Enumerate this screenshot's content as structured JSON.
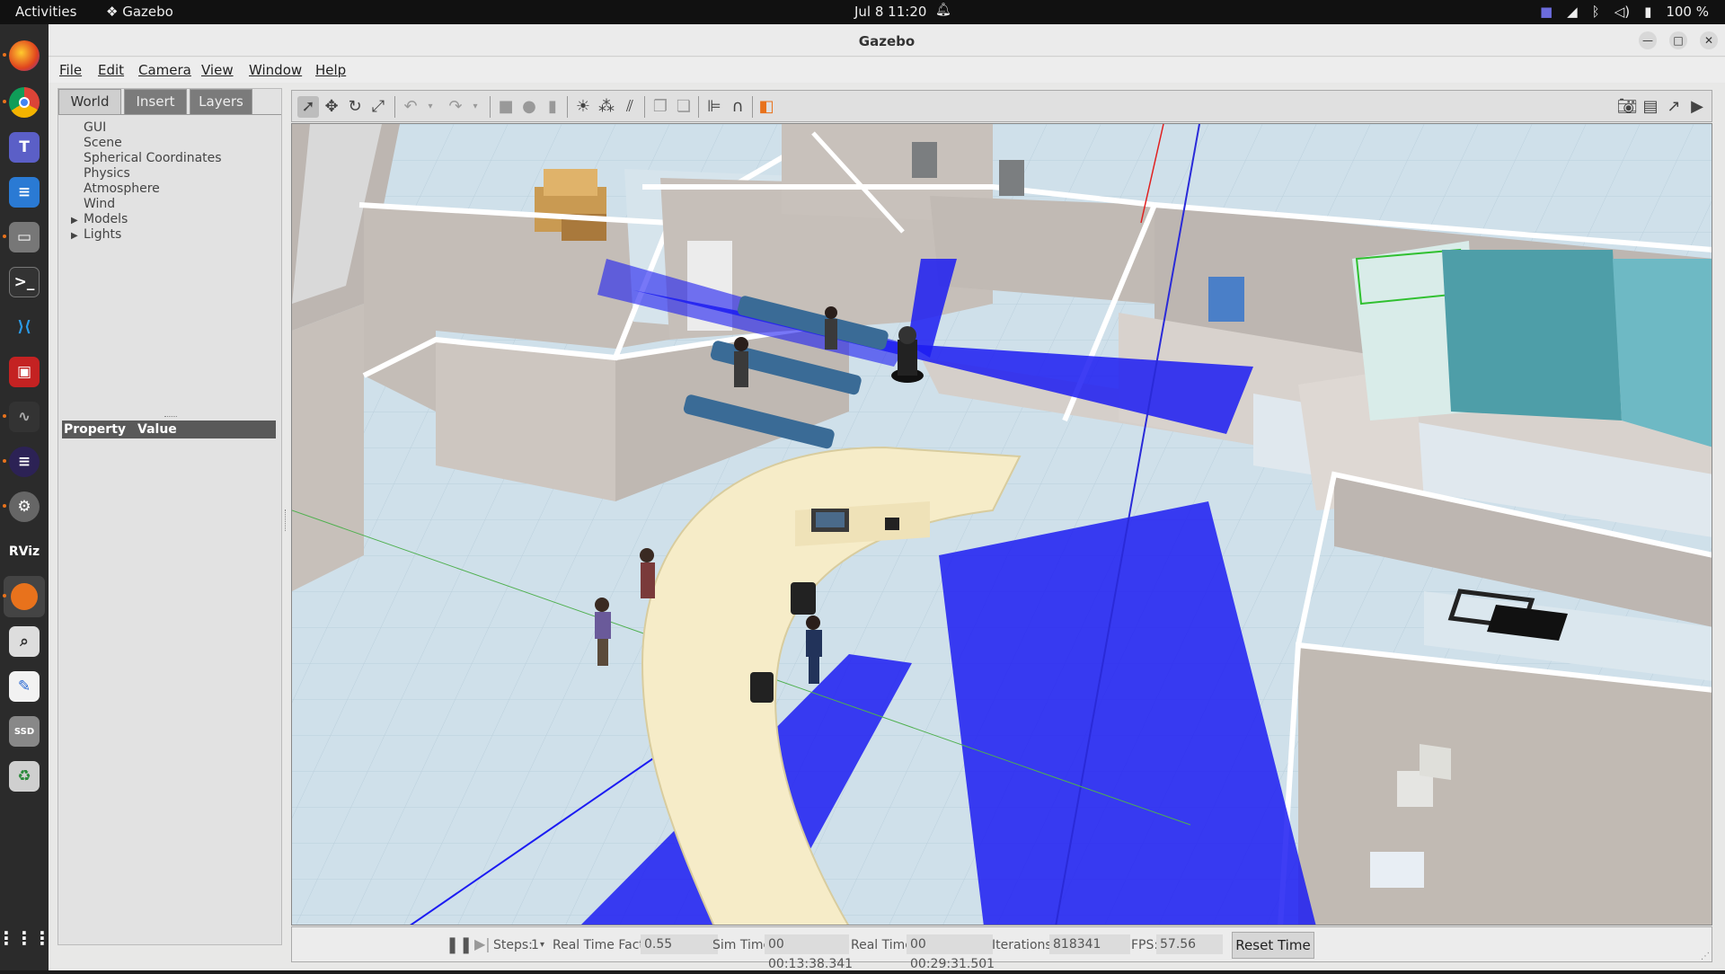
{
  "topbar": {
    "activities": "Activities",
    "app_name": "Gazebo",
    "clock": "Jul 8  11:20",
    "battery": "100 %"
  },
  "dock": {
    "apps": [
      "firefox-icon",
      "chrome-icon",
      "teams-icon",
      "writer-icon",
      "files-icon",
      "terminal-icon",
      "vscode-icon",
      "slides-icon",
      "system-monitor-icon",
      "eclipse-icon",
      "settings-icon",
      "rviz-icon",
      "gazebo-icon",
      "search-icon",
      "text-editor-icon",
      "ssd-icon",
      "trash-icon",
      "apps-grid-icon"
    ],
    "rviz_label": "RViz"
  },
  "window": {
    "title": "Gazebo"
  },
  "menu": {
    "file": "File",
    "edit": "Edit",
    "camera": "Camera",
    "view": "View",
    "window": "Window",
    "help": "Help"
  },
  "left_panel": {
    "tabs": [
      "World",
      "Insert",
      "Layers"
    ],
    "active_tab": "World",
    "tree": [
      "GUI",
      "Scene",
      "Spherical Coordinates",
      "Physics",
      "Atmosphere",
      "Wind"
    ],
    "tree_expandable": [
      "Models",
      "Lights"
    ],
    "property_header": "Property",
    "value_header": "Value"
  },
  "bottom": {
    "steps_label": "Steps:",
    "steps_value": "1",
    "rtf_label": "Real Time Factor:",
    "rtf_value": "0.55",
    "sim_time_label": "Sim Time:",
    "sim_time_value": "00 00:13:38.341",
    "real_time_label": "Real Time:",
    "real_time_value": "00 00:29:31.501",
    "iterations_label": "Iterations:",
    "iterations_value": "818341",
    "fps_label": "FPS:",
    "fps_value": "57.56",
    "reset_label": "Reset Time"
  },
  "colors": {
    "laser": "#1c1cf2",
    "floor": "#cfe0ea",
    "wall_top": "#ffffff",
    "wall_side": "#bdb6b1",
    "desk": "#f6ecc8"
  }
}
